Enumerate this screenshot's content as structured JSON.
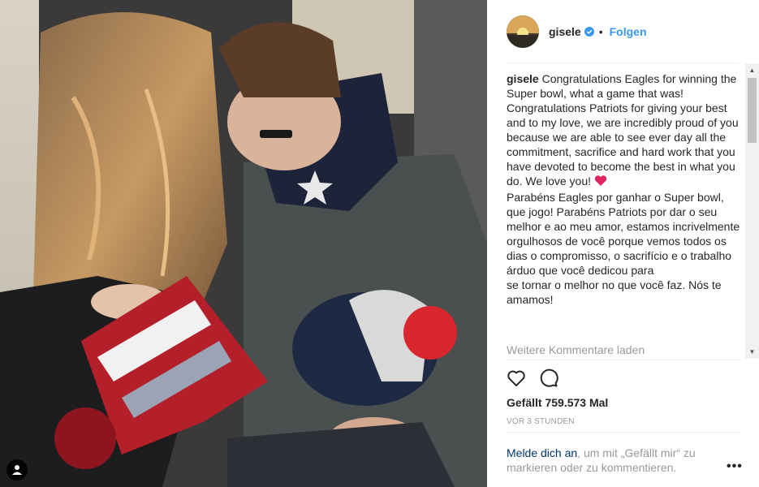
{
  "post": {
    "username": "gisele",
    "follow_label": "Folgen",
    "dot": "•",
    "caption_username": "gisele",
    "caption_paragraph_1": "Congratulations Eagles for winning the Super bowl, what a game that was! Congratulations Patriots for giving your best and to my love, we are incredibly proud of you because we are able to see ever day all the commitment, sacrifice and hard work that you have devoted to become the best in what you do. We love you!",
    "caption_paragraph_2": "Parabéns Eagles por ganhar o Super bowl, que jogo! Parabéns Patriots por dar o seu melhor e ao meu amor, estamos incrivelmente orgulhosos de você porque vemos todos os dias o compromisso, o sacrifício e o trabalho árduo que você dedicou para",
    "caption_paragraph_3": "se tornar o melhor no que você faz. Nós te amamos!",
    "load_more_comments": "Weitere Kommentare laden",
    "likes": "Gefällt 759.573 Mal",
    "timestamp": "VOR 3 STUNDEN",
    "footer_link": "Melde dich an",
    "footer_rest": ", um mit „Gefällt mir“ zu markieren oder zu kommentieren.",
    "more_label": "•••"
  },
  "icons": {
    "verified": "verified-badge-icon",
    "like": "heart-outline-icon",
    "comment": "speech-bubble-icon",
    "user_tag": "person-icon",
    "scroll_up": "▲",
    "scroll_down": "▼"
  },
  "colors": {
    "accent": "#3897f0",
    "link": "#003569",
    "muted": "#999999",
    "heart_emoji": "#e0245e"
  }
}
